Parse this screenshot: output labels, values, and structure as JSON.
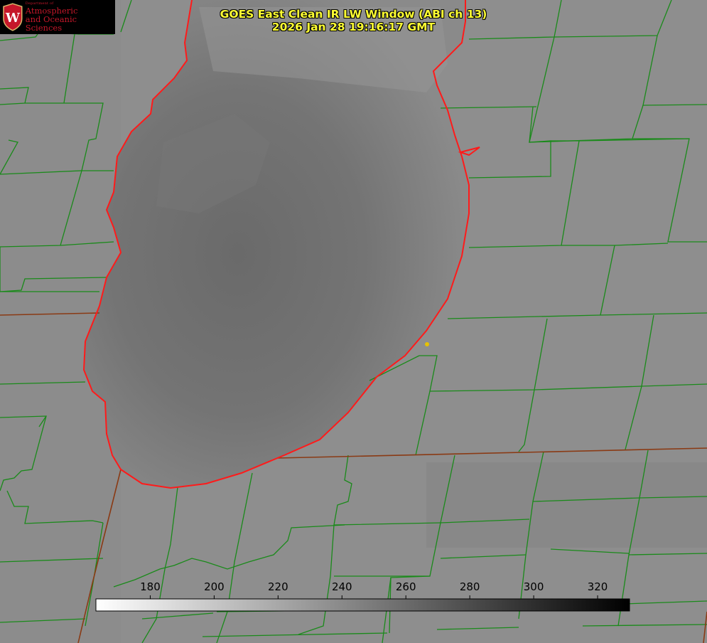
{
  "header": {
    "title_line1": "GOES East Clean IR LW Window (ABI ch 13)",
    "title_line2": "2026 Jan 28 19:16:17 GMT"
  },
  "logo": {
    "dept_line": "Department of",
    "line1": "Atmospheric",
    "line2": "and Oceanic Sciences",
    "seal_letter": "W"
  },
  "colorbar": {
    "ticks": [
      "180",
      "200",
      "220",
      "240",
      "260",
      "280",
      "300",
      "320"
    ],
    "min": 163,
    "max": 330,
    "gradient_start": "#ffffff",
    "gradient_end": "#000000"
  },
  "colors": {
    "lake_outline": "#ff1a1a",
    "county_lines": "#1a8a1a",
    "state_lines": "#8a3a14",
    "title": "#ffff33",
    "logo": "#c5172a",
    "marker": "#e6c200"
  },
  "marker": {
    "icon": "station-marker-dot"
  }
}
